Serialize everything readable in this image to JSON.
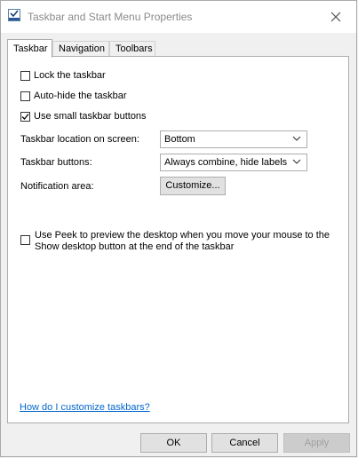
{
  "window": {
    "title": "Taskbar and Start Menu Properties"
  },
  "tabs": [
    {
      "label": "Taskbar",
      "active": true
    },
    {
      "label": "Navigation",
      "active": false
    },
    {
      "label": "Toolbars",
      "active": false
    }
  ],
  "options": {
    "lock_taskbar": {
      "label": "Lock the taskbar",
      "checked": false
    },
    "auto_hide": {
      "label": "Auto-hide the taskbar",
      "checked": false
    },
    "small_buttons": {
      "label": "Use small taskbar buttons",
      "checked": true
    }
  },
  "fields": {
    "location": {
      "label": "Taskbar location on screen:",
      "value": "Bottom"
    },
    "buttons": {
      "label": "Taskbar buttons:",
      "value": "Always combine, hide labels"
    },
    "notification": {
      "label": "Notification area:",
      "button_label": "Customize..."
    }
  },
  "peek": {
    "label_line1": "Use Peek to preview the desktop when you move your mouse to the",
    "label_line2": "Show desktop button at the end of the taskbar",
    "checked": false
  },
  "help_link": "How do I customize taskbars?",
  "footer": {
    "ok": "OK",
    "cancel": "Cancel",
    "apply": "Apply",
    "apply_enabled": false
  },
  "icons": {
    "app": "taskbar-properties-icon",
    "close": "close-icon",
    "dropdown": "chevron-down-icon",
    "check": "checkmark-icon"
  }
}
